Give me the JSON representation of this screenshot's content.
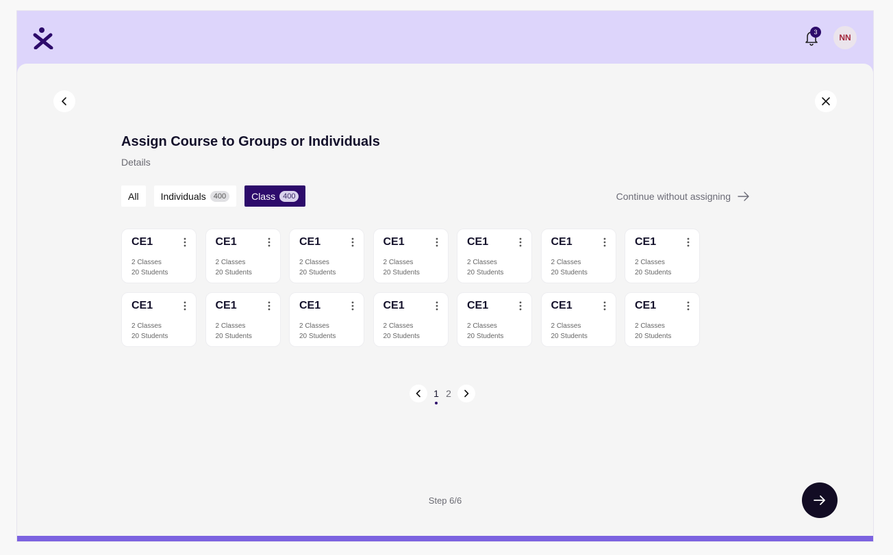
{
  "header": {
    "logo_icon": "logo-x-icon",
    "notification_count": "3",
    "avatar_initials": "NN"
  },
  "page": {
    "title": "Assign Course to Groups or Individuals",
    "subtitle": "Details",
    "continue_label": "Continue without assigning",
    "step_label": "Step 6/6"
  },
  "tabs": [
    {
      "label": "All",
      "count": null,
      "active": false
    },
    {
      "label": "Individuals",
      "count": "400",
      "active": false
    },
    {
      "label": "Class",
      "count": "400",
      "active": true
    }
  ],
  "cards": [
    {
      "title": "CE1",
      "line1": "2 Classes",
      "line2": "20 Students"
    },
    {
      "title": "CE1",
      "line1": "2 Classes",
      "line2": "20 Students"
    },
    {
      "title": "CE1",
      "line1": "2 Classes",
      "line2": "20 Students"
    },
    {
      "title": "CE1",
      "line1": "2 Classes",
      "line2": "20 Students"
    },
    {
      "title": "CE1",
      "line1": "2 Classes",
      "line2": "20 Students"
    },
    {
      "title": "CE1",
      "line1": "2 Classes",
      "line2": "20 Students"
    },
    {
      "title": "CE1",
      "line1": "2 Classes",
      "line2": "20 Students"
    },
    {
      "title": "CE1",
      "line1": "2 Classes",
      "line2": "20 Students"
    },
    {
      "title": "CE1",
      "line1": "2 Classes",
      "line2": "20 Students"
    },
    {
      "title": "CE1",
      "line1": "2 Classes",
      "line2": "20 Students"
    },
    {
      "title": "CE1",
      "line1": "2 Classes",
      "line2": "20 Students"
    },
    {
      "title": "CE1",
      "line1": "2 Classes",
      "line2": "20 Students"
    },
    {
      "title": "CE1",
      "line1": "2 Classes",
      "line2": "20 Students"
    },
    {
      "title": "CE1",
      "line1": "2 Classes",
      "line2": "20 Students"
    }
  ],
  "pagination": {
    "pages": [
      "1",
      "2"
    ],
    "current": "1"
  },
  "colors": {
    "header_bg": "#ddd5fb",
    "accent": "#2d0b6b",
    "bottom_bar": "#7c63e0",
    "next_button": "#120c24"
  }
}
